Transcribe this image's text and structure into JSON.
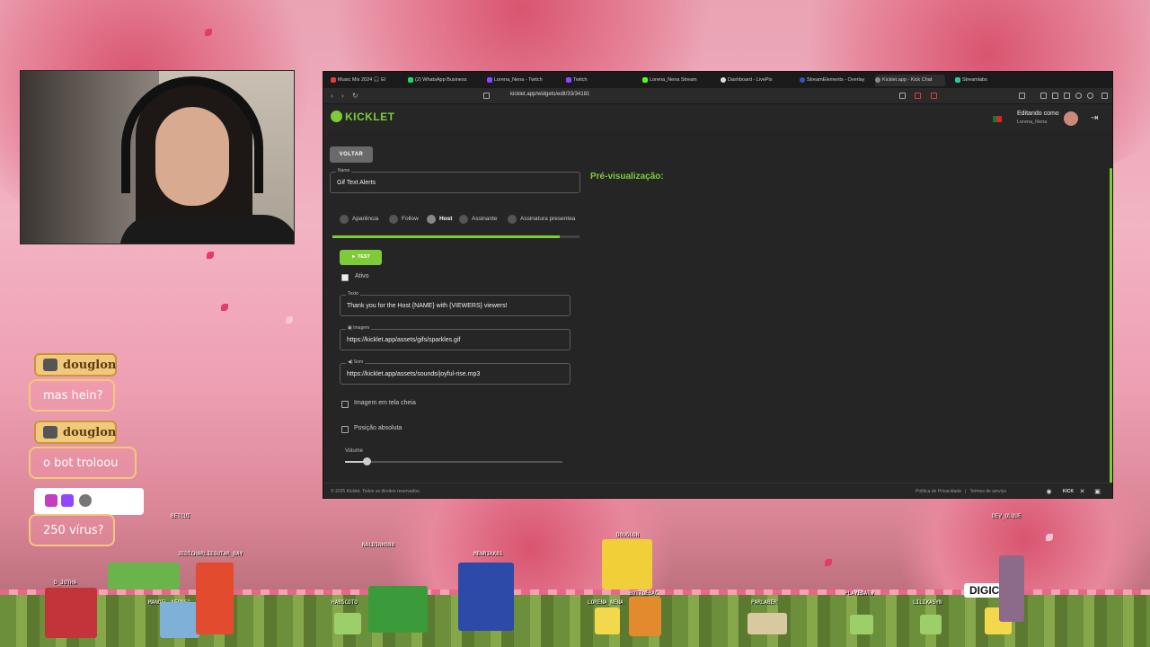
{
  "browser": {
    "tabs": [
      {
        "label": "Music Mix 2024 🎧 El",
        "color": "#e23c3c"
      },
      {
        "label": "(2) WhatsApp Business",
        "color": "#25d366"
      },
      {
        "label": "Lorena_Nena - Twitch",
        "color": "#9146ff"
      },
      {
        "label": "Twitch",
        "color": "#9146ff"
      },
      {
        "label": "Lorena_Nena Stream",
        "color": "#53fc18"
      },
      {
        "label": "Dashboard - LivePix",
        "color": "#dddddd"
      },
      {
        "label": "StreamElements - Overlay",
        "color": "#3f51b5"
      },
      {
        "label": "Kicklet.app - Kick Chat",
        "color": "#888888"
      },
      {
        "label": "Streamlabs",
        "color": "#31c3a2"
      }
    ],
    "url": "kicklet.app/widgets/edit/33/34181"
  },
  "app": {
    "logo": "KICKLET",
    "editing_label": "Editando como",
    "editing_user": "Lorena_Nena",
    "logout_icon": "logout-icon",
    "back_button": "VOLTAR",
    "name_label": "Name",
    "name_value": "Gif Text Alerts",
    "preview_label": "Pré-visualização:",
    "steps": [
      {
        "label": "Aparência",
        "state": "todo"
      },
      {
        "label": "Follow",
        "state": "todo"
      },
      {
        "label": "Host",
        "state": "active"
      },
      {
        "label": "Assinante",
        "state": "todo"
      },
      {
        "label": "Assinatura presentea",
        "state": "todo"
      }
    ],
    "progress": 0.92,
    "test_button": "► TEST",
    "ativo_label": "Ativo",
    "texto_label": "Texto",
    "texto_value": "Thank you for the Host {NAME} with {VIEWERS} viewers!",
    "imagem_label": "Imagem",
    "imagem_value": "https://kicklet.app/assets/gifs/sparkles.gif",
    "som_label": "Som",
    "som_value": "https://kicklet.app/assets/sounds/joyful-rise.mp3",
    "fullscreen_label": "Imagem em tela cheia",
    "absolute_label": "Posição absoluta",
    "volume_label": "Volume",
    "volume_value": 0.1,
    "footer_copy": "© 2025 Kicklet. Todos os direitos reservados.",
    "footer_privacy": "Política de Privacidade",
    "footer_sep": "|",
    "footer_terms": "Termos de serviço",
    "accent": "#7ecb3a"
  },
  "chat": [
    {
      "name": "douglon",
      "text": "mas hein?"
    },
    {
      "name": "douglon",
      "text": "o bot troloou"
    },
    {
      "name": "",
      "text": "250 vírus?"
    }
  ],
  "game": {
    "labels": [
      "BETCUI",
      "JEDICHARLIESUTAR_BAY",
      "D_JOTHA",
      "MANOEL_AFONSO",
      "NALDINHO88",
      "MENRIKK81",
      "DOUGLON",
      "HABSCOTO",
      "LORENA_NENA",
      "BOTTOEBAC",
      "PARLABER",
      "PLAYEOATW",
      "LILIKASYN",
      "DEV_OLQUE"
    ],
    "highlight": "DIGICIL"
  }
}
